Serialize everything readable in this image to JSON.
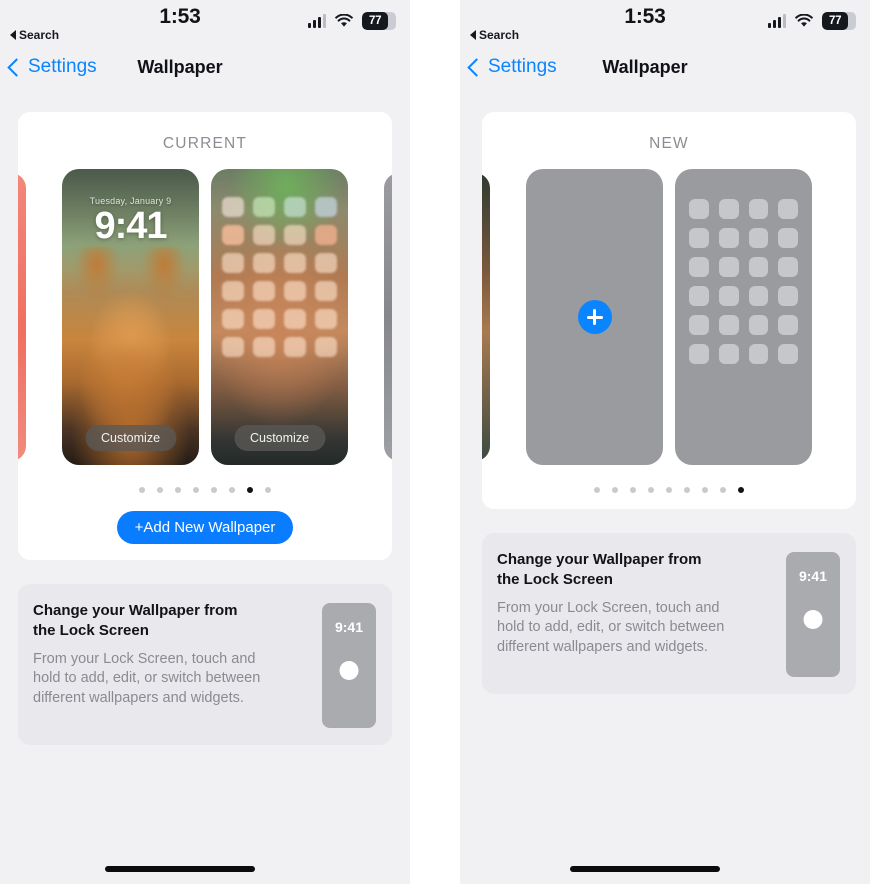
{
  "status_bar": {
    "time": "1:53",
    "back_label": "Search",
    "battery_percent": "77",
    "signal_icon": "cellular-signal-icon",
    "wifi_icon": "wifi-icon",
    "battery_icon": "battery-icon"
  },
  "nav": {
    "back_label": "Settings",
    "title": "Wallpaper"
  },
  "left_panel": {
    "card_title": "CURRENT",
    "lock_preview": {
      "date": "Tuesday, January 9",
      "time": "9:41",
      "customize_label": "Customize"
    },
    "home_preview": {
      "customize_label": "Customize"
    },
    "dots_count": 8,
    "dots_active_index": 6,
    "add_button_label": "+Add New Wallpaper"
  },
  "right_panel": {
    "card_title": "NEW",
    "add_icon": "plus-icon",
    "dots_count": 9,
    "dots_active_index": 8
  },
  "info_card": {
    "title": "Change your Wallpaper from the Lock Screen",
    "body": "From your Lock Screen, touch and hold to add, edit, or switch between different wallpapers and widgets.",
    "thumb_time": "9:41"
  },
  "colors": {
    "accent_blue": "#0a84ff",
    "add_button_blue": "#0a7cff",
    "page_background": "#f1f1f4",
    "card_background": "#ffffff",
    "info_background": "#e9e9ed",
    "placeholder_gray": "#9a9b9f"
  }
}
